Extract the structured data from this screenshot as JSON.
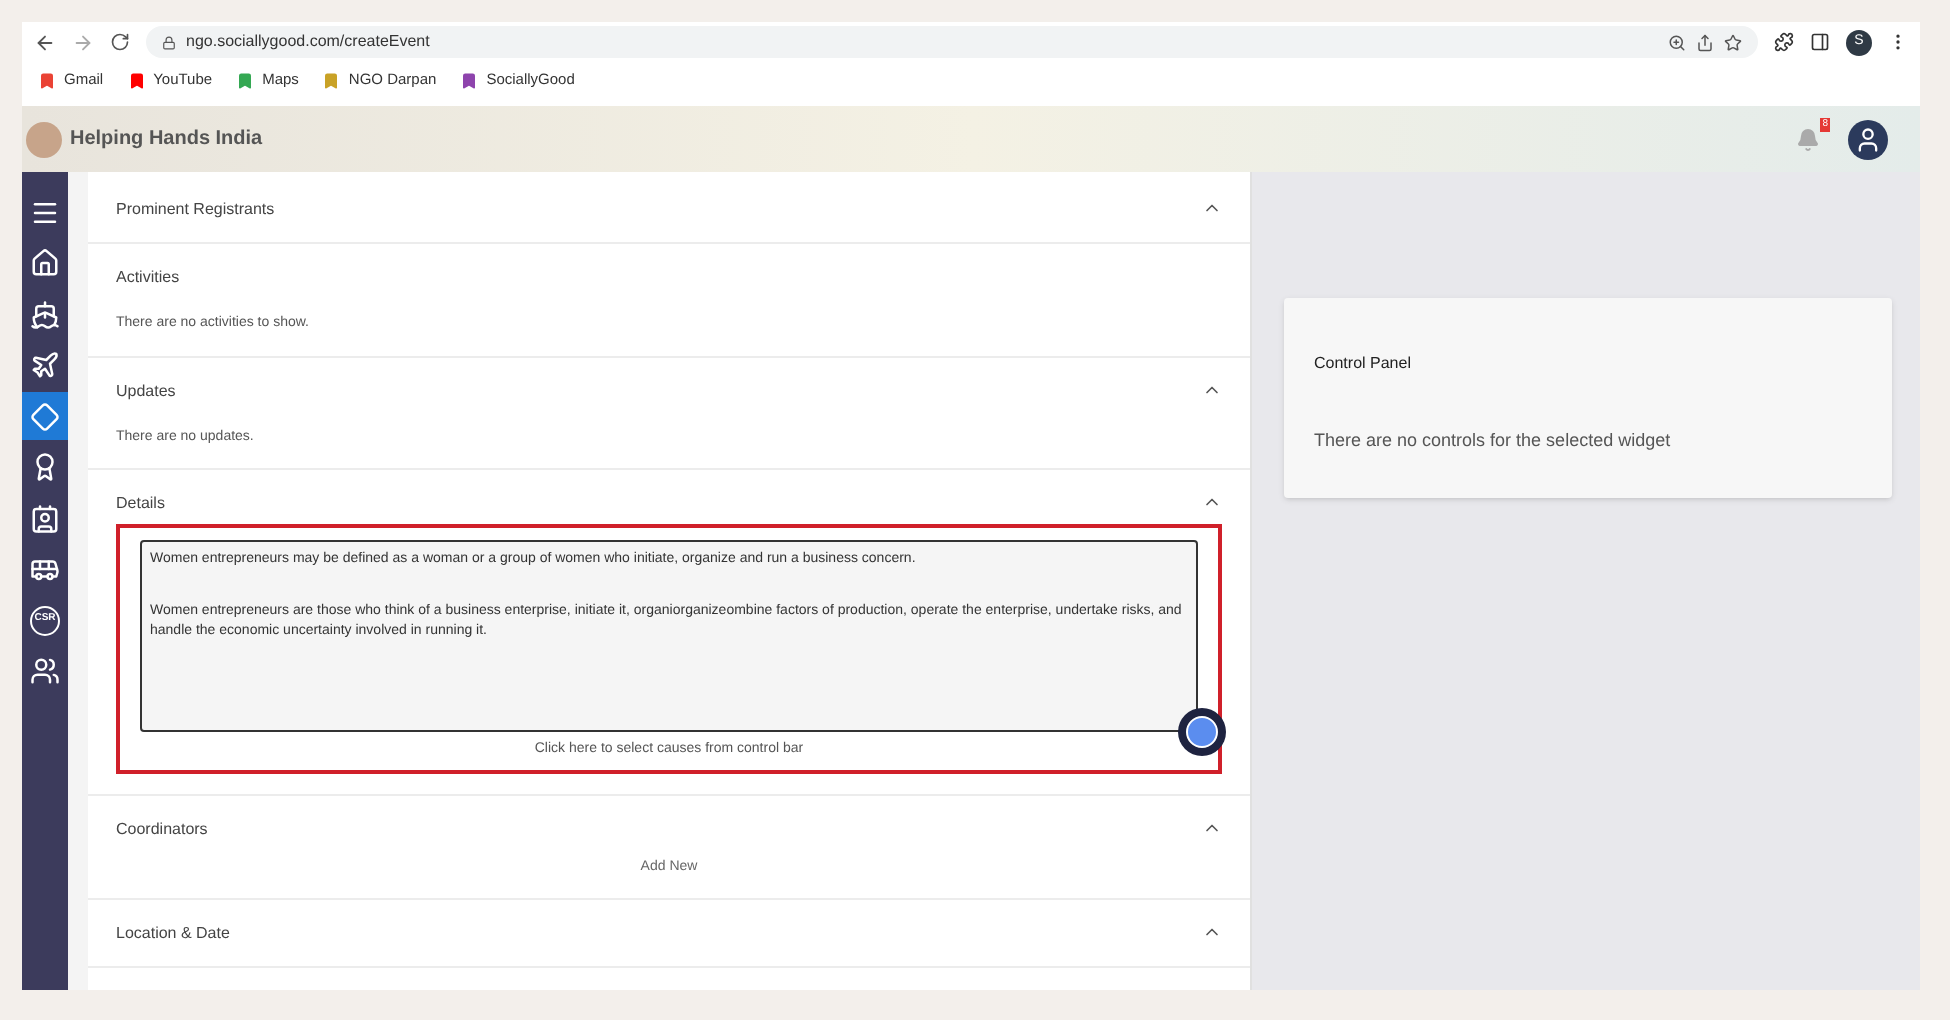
{
  "browser": {
    "url": "ngo.sociallygood.com/createEvent",
    "profile": "S",
    "bookmarks": [
      {
        "label": "Gmail",
        "color": "#ea4335"
      },
      {
        "label": "YouTube",
        "color": "#ff0000"
      },
      {
        "label": "Maps",
        "color": "#34a853"
      },
      {
        "label": "NGO Darpan",
        "color": "#c9a227"
      },
      {
        "label": "SociallyGood",
        "color": "#8e44ad"
      }
    ]
  },
  "header": {
    "org_name": "Helping Hands India",
    "notification_count": "8"
  },
  "sidebar": {
    "items": [
      {
        "kind": "menu",
        "selected": false
      },
      {
        "kind": "home",
        "selected": false
      },
      {
        "kind": "ship",
        "selected": false
      },
      {
        "kind": "plane",
        "selected": false
      },
      {
        "kind": "diamond",
        "selected": true
      },
      {
        "kind": "award",
        "selected": false
      },
      {
        "kind": "contact",
        "selected": false
      },
      {
        "kind": "bus",
        "selected": false
      },
      {
        "kind": "csr",
        "selected": false,
        "label": "CSR"
      },
      {
        "kind": "users",
        "selected": false
      }
    ]
  },
  "sections": [
    {
      "title": "Prominent Registrants",
      "expanded": true
    },
    {
      "title": "Activities",
      "expanded": false,
      "message": "There are no activities to show."
    },
    {
      "title": "Updates",
      "expanded": true,
      "message": "There are no updates."
    },
    {
      "title": "Details",
      "expanded": true,
      "highlighted": true,
      "paragraphs": [
        "Women entrepreneurs may be defined as a woman or a group of women who initiate, organize and run a business concern.",
        "Women entrepreneurs are those who think of a business enterprise, initiate it, organiorganizeombine factors of production, operate the enterprise, undertake risks, and handle the economic uncertainty involved in running it."
      ],
      "hint": "Click here to select causes from control bar"
    },
    {
      "title": "Coordinators",
      "expanded": true,
      "action": "Add New"
    },
    {
      "title": "Location & Date",
      "expanded": true
    }
  ],
  "control_panel": {
    "title": "Control Panel",
    "message": "There are no controls for the selected widget"
  }
}
